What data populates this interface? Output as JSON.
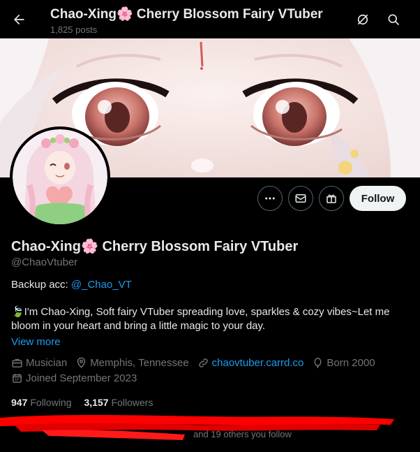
{
  "header": {
    "title": "Chao-Xing🌸 Cherry Blossom Fairy VTuber",
    "post_count": "1,825 posts",
    "back_icon": "arrow-left-icon",
    "grok_icon": "grok-icon",
    "search_icon": "search-icon"
  },
  "profile": {
    "display_name": "Chao-Xing🌸 Cherry Blossom Fairy VTuber",
    "handle": "@ChaoVtuber",
    "backup_prefix": "Backup acc: ",
    "backup_link": "@_Chao_VT",
    "bio": "🍃I'm Chao-Xing, Soft fairy VTuber spreading love, sparkles & cozy vibes~Let me bloom in your heart and bring a little magic to your day.",
    "view_more": "View more",
    "category": "Musician",
    "location": "Memphis, Tennessee",
    "website": "chaovtuber.carrd.co",
    "born": "Born 2000",
    "joined": "Joined September 2023",
    "following_count": "947",
    "following_label": "Following",
    "followers_count": "3,157",
    "followers_label": "Followers",
    "followed_by_suffix": "and 19 others you follow"
  },
  "actions": {
    "follow_label": "Follow",
    "more_icon": "more-icon",
    "message_icon": "envelope-icon",
    "subscribe_icon": "gift-icon"
  },
  "colors": {
    "background": "#000000",
    "text": "#e7e9ea",
    "muted": "#71767b",
    "link": "#1d9bf0",
    "follow_button_bg": "#eff3f4",
    "redaction": "#ff0000"
  }
}
